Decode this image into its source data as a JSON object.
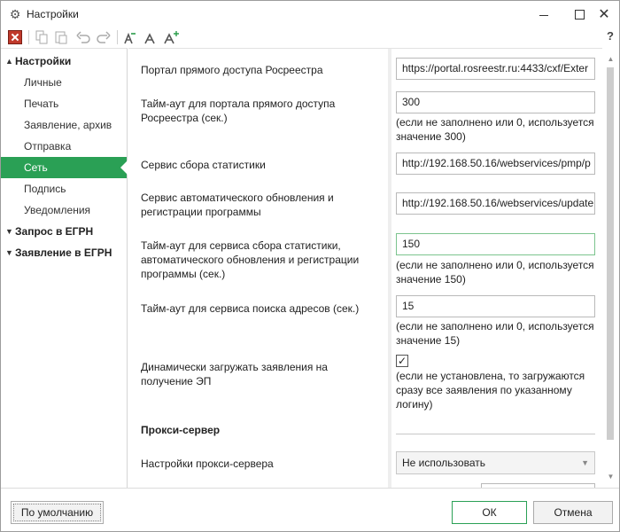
{
  "window": {
    "title": "Настройки",
    "icon": "gears-icon",
    "controls": [
      "minimize",
      "maximize",
      "close"
    ],
    "close_glyph": "✕"
  },
  "toolbar": {
    "buttons": [
      "exit-icon",
      "copy-icon",
      "paste-icon",
      "undo-icon",
      "redo-icon",
      "font-decrease-icon",
      "font-reset-icon",
      "font-increase-icon"
    ],
    "help_label": "?"
  },
  "sidebar": {
    "groups": [
      {
        "label": "Настройки",
        "expanded": true,
        "items": [
          "Личные",
          "Печать",
          "Заявление, архив",
          "Отправка",
          "Сеть",
          "Подпись",
          "Уведомления"
        ]
      },
      {
        "label": "Запрос в ЕГРН",
        "expanded": false
      },
      {
        "label": "Заявление в ЕГРН",
        "expanded": false
      }
    ],
    "active_item": "Сеть"
  },
  "main": {
    "portal_label": "Портал прямого доступа Росреестра",
    "portal_value": "https://portal.rosreestr.ru:4433/cxf/Exter",
    "portal_timeout_label": "Тайм-аут для портала прямого доступа Росреестра (сек.)",
    "portal_timeout_value": "300",
    "portal_timeout_hint": "(если не заполнено или 0, используется значение 300)",
    "stats_label": "Сервис сбора статистики",
    "stats_value": "http://192.168.50.16/webservices/pmp/p",
    "update_label": "Сервис автоматического обновления и регистрации программы",
    "update_value": "http://192.168.50.16/webservices/update",
    "stats_timeout_label": "Тайм-аут для сервиса сбора статистики, автоматического обновления и регистрации программы (сек.)",
    "stats_timeout_value": "150",
    "stats_timeout_hint": "(если не заполнено или 0, используется значение 150)",
    "address_timeout_label": "Тайм-аут для сервиса поиска адресов (сек.)",
    "address_timeout_value": "15",
    "address_timeout_hint": "(если не заполнено или 0, используется значение 15)",
    "dynamic_label": "Динамически загружать заявления на получение ЭП",
    "dynamic_checked": true,
    "dynamic_hint": "(если не установлена, то загружаются сразу все заявления по указанному логину)",
    "proxy_heading": "Прокси-сервер",
    "proxy_label": "Настройки прокси-сервера",
    "proxy_value": "Не использовать"
  },
  "footer": {
    "default_label": "По умолчанию",
    "ok_label": "ОК",
    "cancel_label": "Отмена"
  }
}
